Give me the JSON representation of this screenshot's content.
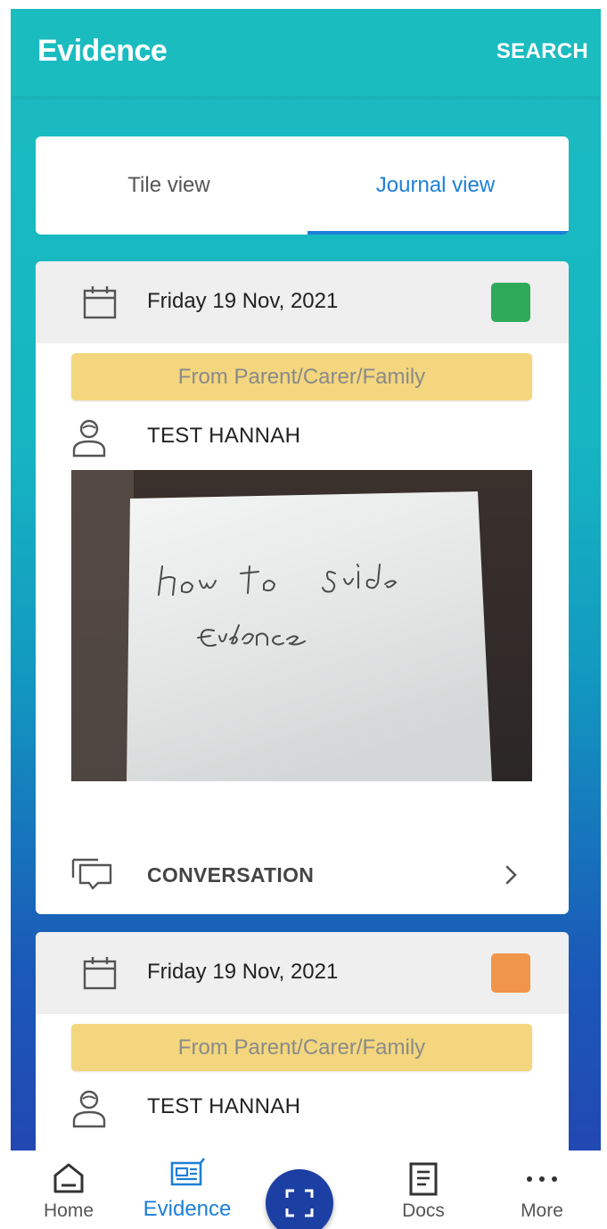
{
  "app_bar": {
    "title": "Evidence",
    "search_label": "SEARCH"
  },
  "view_tabs": {
    "tile_label": "Tile view",
    "journal_label": "Journal view",
    "active": "journal"
  },
  "entries": [
    {
      "date": "Friday 19 Nov, 2021",
      "status_color": "#2eaa5a",
      "source": "From Parent/Carer/Family",
      "person": "TEST  HANNAH",
      "photo_icon": "handwritten-note-photo",
      "conversation_label": "CONVERSATION"
    },
    {
      "date": "Friday 19 Nov, 2021",
      "status_color": "#f0964a",
      "source": "From Parent/Carer/Family",
      "person": "TEST  HANNAH"
    }
  ],
  "bottom_nav": {
    "home": "Home",
    "evidence": "Evidence",
    "docs": "Docs",
    "more": "More",
    "active": "evidence"
  },
  "colors": {
    "accent": "#1d7fd8",
    "appbar": "#1bbcc0",
    "fab": "#1c3fa4",
    "banner": "#f3d67e"
  }
}
